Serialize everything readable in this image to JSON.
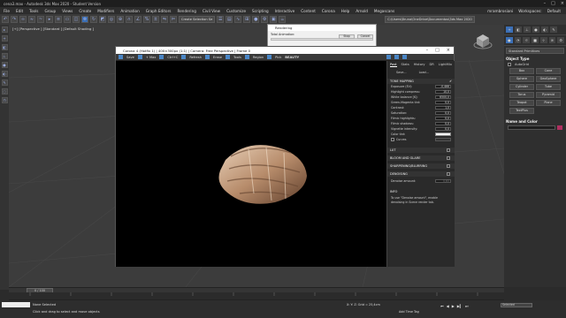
{
  "app": {
    "title": "cena3.max - Autodesk 3ds Max 2020 - Student Version"
  },
  "menu": [
    "File",
    "Edit",
    "Tools",
    "Group",
    "Views",
    "Create",
    "Modifiers",
    "Animation",
    "Graph Editors",
    "Rendering",
    "Civil View",
    "Customize",
    "Scripting",
    "Interactive",
    "Content",
    "Corona",
    "Help",
    "Arnold",
    "Megascans"
  ],
  "menu_right": {
    "user": "mrambrosiani",
    "workspaces_label": "Workspaces:",
    "workspace": "Default"
  },
  "toolbar": {
    "selection_set": "Create Selection Se",
    "path": "C:\\Users\\Bruna\\OneDrive\\Documentos\\3ds Max 2020"
  },
  "viewport": {
    "label": "[+] [Perspective ] [Standard ] [Default Shading ]"
  },
  "rendering_dialog": {
    "title": "Rendering",
    "total_animation": "Total Animation:",
    "stop": "Stop",
    "cancel": "Cancel"
  },
  "vfb": {
    "title": "Corona 4 (Hotfix 1) | 400×300px (1:1) | Camera: Free Perspective | Frame 0",
    "tools": [
      "Save",
      "+ Max",
      "Ctrl+C",
      "Refresh",
      "Erase",
      "Tools",
      "Region",
      "Pick",
      "BEAUTY"
    ],
    "tabs": [
      "Post",
      "Stats",
      "History",
      "DR",
      "LightMix"
    ],
    "save": "Save...",
    "load": "Load...",
    "tone_mapping": "TONE MAPPING",
    "params": [
      {
        "label": "Exposure (EV):",
        "value": "-0,466"
      },
      {
        "label": "Highlight compress:",
        "value": "10,0"
      },
      {
        "label": "White balance [K]:",
        "value": "6500,0"
      },
      {
        "label": "Green-Magenta tint:",
        "value": "0,0"
      },
      {
        "label": "Contrast:",
        "value": "1,0"
      },
      {
        "label": "Saturation:",
        "value": "0,0"
      },
      {
        "label": "Filmic highlights:",
        "value": "0,0"
      },
      {
        "label": "Filmic shadows:",
        "value": "0,0"
      },
      {
        "label": "Vignette intensity:",
        "value": "0,0"
      }
    ],
    "color_tint": "Color tint:",
    "curves": "Curves",
    "sections": [
      "LUT",
      "BLOOM AND GLARE",
      "SHARPENING/BLURRING",
      "DENOISING"
    ],
    "denoise_amount": "Denoise amount:",
    "denoise_value": "0,65",
    "info_header": "INFO",
    "info_text": "To use \"Denoise amount\", enable denoising in Scene render tab."
  },
  "command_panel": {
    "dropdown": "Standard Primitives",
    "object_type": "Object Type",
    "autogrid": "AutoGrid",
    "primitives": [
      "Box",
      "Cone",
      "Sphere",
      "GeoSphere",
      "Cylinder",
      "Tube",
      "Torus",
      "Pyramid",
      "Teapot",
      "Plane",
      "TextPlus",
      ""
    ],
    "name_color": "Name and Color"
  },
  "timeline": {
    "frame": "0 / 100"
  },
  "status": {
    "selection": "None Selected",
    "prompt": "Click and drag to select and move objects",
    "coords": "X:   Y:   Z:   Grid = 25,4cm",
    "add_time_tag": "Add Time Tag",
    "key_filter": "Selected"
  }
}
